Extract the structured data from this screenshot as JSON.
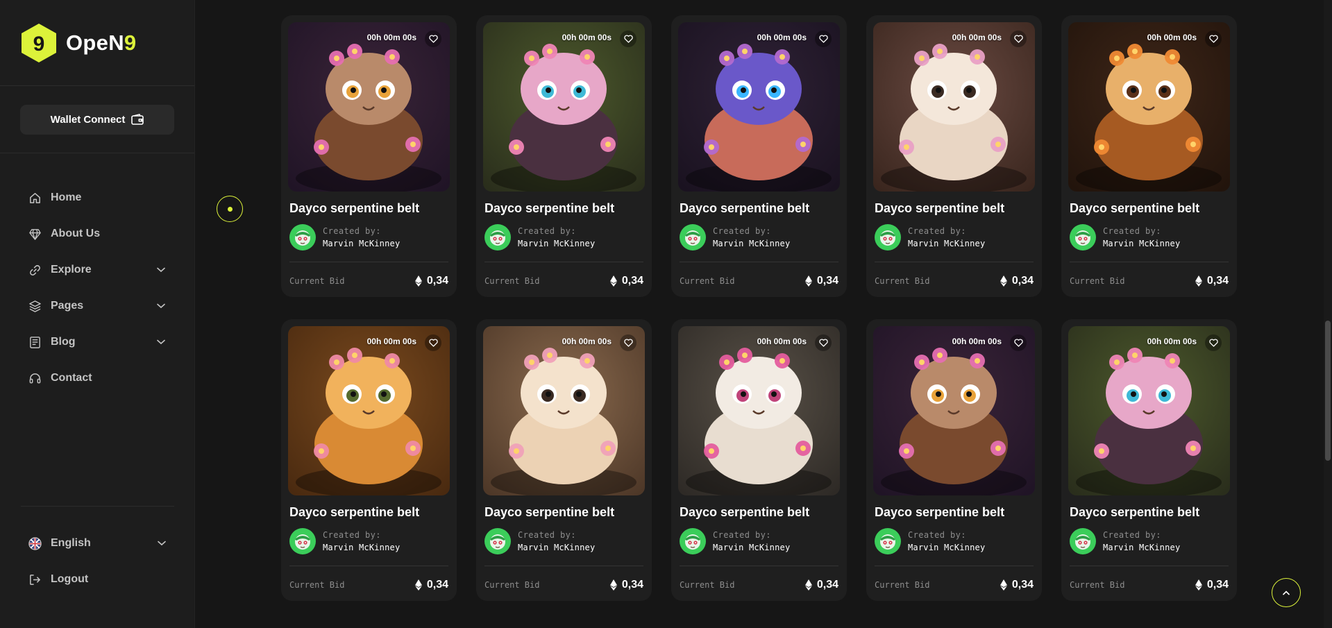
{
  "brand": {
    "name_main": "OpeN",
    "name_accent": "9",
    "logo_digit": "9"
  },
  "wallet": {
    "label": "Wallet Connect",
    "icon": "wallet-icon"
  },
  "nav": [
    {
      "key": "home",
      "label": "Home",
      "icon": "home-icon",
      "has_chevron": false
    },
    {
      "key": "about",
      "label": "About Us",
      "icon": "diamond-icon",
      "has_chevron": false
    },
    {
      "key": "explore",
      "label": "Explore",
      "icon": "link-icon",
      "has_chevron": true
    },
    {
      "key": "pages",
      "label": "Pages",
      "icon": "layers-icon",
      "has_chevron": true
    },
    {
      "key": "blog",
      "label": "Blog",
      "icon": "document-icon",
      "has_chevron": true
    },
    {
      "key": "contact",
      "label": "Contact",
      "icon": "headset-icon",
      "has_chevron": false
    }
  ],
  "language": {
    "label": "English",
    "icon": "uk-flag-icon"
  },
  "logout": {
    "label": "Logout",
    "icon": "logout-icon"
  },
  "colors": {
    "accent": "#dcf23a",
    "background": "#161616",
    "sidebar": "#1d1d1d",
    "card": "#1f1f1f",
    "avatar": "#3bcd5a"
  },
  "cards": [
    {
      "timer": "00h 00m 00s",
      "title": "Dayco serpentine belt",
      "created_by": "Created by:",
      "creator": "Marvin McKinney",
      "bid_label": "Current Bid",
      "bid": "0,34",
      "art": "teapot-owl"
    },
    {
      "timer": "00h 00m 00s",
      "title": "Dayco serpentine belt",
      "created_by": "Created by:",
      "creator": "Marvin McKinney",
      "bid_label": "Current Bid",
      "bid": "0,34",
      "art": "dragon-pots"
    },
    {
      "timer": "00h 00m 00s",
      "title": "Dayco serpentine belt",
      "created_by": "Created by:",
      "creator": "Marvin McKinney",
      "bid_label": "Current Bid",
      "bid": "0,34",
      "art": "cup-monster"
    },
    {
      "timer": "00h 00m 00s",
      "title": "Dayco serpentine belt",
      "created_by": "Created by:",
      "creator": "Marvin McKinney",
      "bid_label": "Current Bid",
      "bid": "0,34",
      "art": "bun-bunny"
    },
    {
      "timer": "00h 00m 00s",
      "title": "Dayco serpentine belt",
      "created_by": "Created by:",
      "creator": "Marvin McKinney",
      "bid_label": "Current Bid",
      "bid": "0,34",
      "art": "bread-cats"
    },
    {
      "timer": "00h 00m 00s",
      "title": "Dayco serpentine belt",
      "created_by": "Created by:",
      "creator": "Marvin McKinney",
      "bid_label": "Current Bid",
      "bid": "0,34",
      "art": "bread-tiger"
    },
    {
      "timer": "00h 00m 00s",
      "title": "Dayco serpentine belt",
      "created_by": "Created by:",
      "creator": "Marvin McKinney",
      "bid_label": "Current Bid",
      "bid": "0,34",
      "art": "bun-puppy"
    },
    {
      "timer": "00h 00m 00s",
      "title": "Dayco serpentine belt",
      "created_by": "Created by:",
      "creator": "Marvin McKinney",
      "bid_label": "Current Bid",
      "bid": "0,34",
      "art": "floral-fox"
    },
    {
      "timer": "00h 00m 00s",
      "title": "Dayco serpentine belt",
      "created_by": "Created by:",
      "creator": "Marvin McKinney",
      "bid_label": "Current Bid",
      "bid": "0,34",
      "art": "teapot-owl"
    },
    {
      "timer": "00h 00m 00s",
      "title": "Dayco serpentine belt",
      "created_by": "Created by:",
      "creator": "Marvin McKinney",
      "bid_label": "Current Bid",
      "bid": "0,34",
      "art": "dragon-pots"
    }
  ]
}
